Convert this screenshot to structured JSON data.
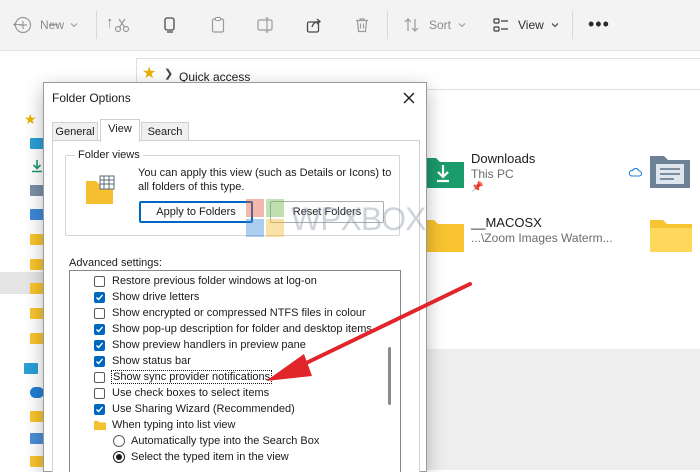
{
  "toolbar": {
    "new_label": "New",
    "sort_label": "Sort",
    "view_label": "View"
  },
  "addressbar": {
    "location": "Quick access"
  },
  "content": {
    "items": [
      {
        "title": "Downloads",
        "subtitle": "This PC"
      },
      {
        "title": "__MACOSX",
        "subtitle": "...\\Zoom Images Waterm..."
      }
    ]
  },
  "dialog": {
    "title": "Folder Options",
    "tabs": [
      {
        "label": "General"
      },
      {
        "label": "View"
      },
      {
        "label": "Search"
      }
    ],
    "active_tab": "View",
    "folder_views": {
      "label": "Folder views",
      "description": "You can apply this view (such as Details or Icons) to all folders of this type.",
      "apply_button": "Apply to Folders",
      "reset_button": "Reset Folders"
    },
    "advanced_label": "Advanced settings:",
    "settings": [
      {
        "label": "Restore previous folder windows at log-on",
        "checked": false
      },
      {
        "label": "Show drive letters",
        "checked": true
      },
      {
        "label": "Show encrypted or compressed NTFS files in colour",
        "checked": false
      },
      {
        "label": "Show pop-up description for folder and desktop items",
        "checked": true
      },
      {
        "label": "Show preview handlers in preview pane",
        "checked": true
      },
      {
        "label": "Show status bar",
        "checked": true
      },
      {
        "label": "Show sync provider notifications",
        "checked": false
      },
      {
        "label": "Use check boxes to select items",
        "checked": false
      },
      {
        "label": "Use Sharing Wizard (Recommended)",
        "checked": true
      },
      {
        "label": "When typing into list view"
      },
      {
        "label": "Automatically type into the Search Box",
        "selected": false
      },
      {
        "label": "Select the typed item in the view",
        "selected": true
      }
    ]
  },
  "watermark": {
    "text": "WPXBOX"
  },
  "colors": {
    "accent": "#0067c0",
    "arrow": "#e0252b",
    "folder": "#f8c42f",
    "downloads_icon": "#1a9c6d"
  }
}
